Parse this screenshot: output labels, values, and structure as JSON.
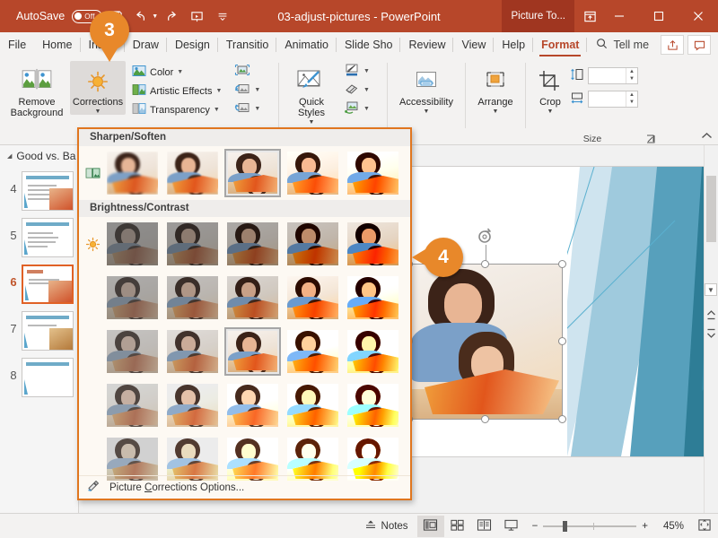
{
  "titlebar": {
    "autosave_label": "AutoSave",
    "autosave_state": "Off",
    "document_title": "03-adjust-pictures  -  PowerPoint",
    "context_tab_badge": "Picture To...",
    "qat": [
      {
        "name": "save-icon",
        "label": "Save"
      },
      {
        "name": "undo-icon",
        "label": "Undo"
      },
      {
        "name": "redo-icon",
        "label": "Redo"
      },
      {
        "name": "start-presentation-icon",
        "label": "Start From Beginning"
      },
      {
        "name": "customize-qat-icon",
        "label": "Customize Quick Access Toolbar"
      }
    ],
    "window_buttons": [
      "minimize",
      "maximize",
      "close"
    ],
    "accent_color": "#b7472a",
    "badge_color": "#a03620"
  },
  "tabs": [
    {
      "label": "File"
    },
    {
      "label": "Home"
    },
    {
      "label": "Insert"
    },
    {
      "label": "Draw"
    },
    {
      "label": "Design"
    },
    {
      "label": "Transitio"
    },
    {
      "label": "Animatio"
    },
    {
      "label": "Slide Sho"
    },
    {
      "label": "Review"
    },
    {
      "label": "View"
    },
    {
      "label": "Help"
    },
    {
      "label": "Format",
      "active": true
    }
  ],
  "tellme": {
    "label": "Tell me",
    "icon": "search-icon"
  },
  "tab_right_buttons": [
    {
      "name": "share-button",
      "icon": "share-icon"
    },
    {
      "name": "comments-button",
      "icon": "comment-icon"
    }
  ],
  "ribbon": {
    "groups": [
      {
        "id": "adjust",
        "label": "",
        "big_buttons": [
          {
            "label": "Remove\nBackground",
            "name": "remove-background-button",
            "icon": "remove-background-icon",
            "selected": false
          },
          {
            "label": "Corrections",
            "name": "corrections-button",
            "icon": "sun-icon",
            "selected": true,
            "has_caret": true
          }
        ],
        "small_buttons": [
          {
            "label": "Color",
            "name": "color-button",
            "icon": "color-picture-icon",
            "caret": true
          },
          {
            "label": "Artistic Effects",
            "name": "artistic-effects-button",
            "icon": "artistic-effects-icon",
            "caret": true
          },
          {
            "label": "Transparency",
            "name": "transparency-button",
            "icon": "transparency-icon",
            "caret": true
          }
        ],
        "icon_buttons": [
          {
            "name": "compress-pictures-button",
            "icon": "compress-picture-icon",
            "caret": false
          },
          {
            "name": "change-picture-button",
            "icon": "change-picture-icon",
            "caret": true
          },
          {
            "name": "reset-picture-button",
            "icon": "reset-picture-icon",
            "caret": true
          }
        ]
      },
      {
        "id": "picture-styles",
        "label": "",
        "big_buttons": [
          {
            "label": "Quick\nStyles",
            "name": "quick-styles-button",
            "icon": "quick-styles-icon",
            "has_caret": true
          }
        ],
        "icon_buttons": [
          {
            "name": "picture-border-button",
            "icon": "pen-border-icon",
            "caret": true
          },
          {
            "name": "picture-effects-button",
            "icon": "eraser-effects-icon",
            "caret": true
          },
          {
            "name": "picture-layout-button",
            "icon": "picture-layout-icon",
            "caret": true
          }
        ]
      },
      {
        "id": "accessibility",
        "label": "",
        "big_buttons": [
          {
            "label": "Accessibility",
            "name": "accessibility-button",
            "icon": "accessibility-icon",
            "has_caret": true
          }
        ]
      },
      {
        "id": "arrange",
        "label": "",
        "big_buttons": [
          {
            "label": "Arrange",
            "name": "arrange-button",
            "icon": "arrange-icon",
            "has_caret": true
          }
        ]
      },
      {
        "id": "size",
        "label": "Size",
        "big_buttons": [
          {
            "label": "Crop",
            "name": "crop-button",
            "icon": "crop-icon",
            "has_caret": true
          }
        ],
        "spinners": [
          {
            "name": "shape-height-input",
            "icon": "height-icon",
            "value": "",
            "placeholder": ""
          },
          {
            "name": "shape-width-input",
            "icon": "width-icon",
            "value": "",
            "placeholder": ""
          }
        ],
        "dialog_launcher": "⊿"
      }
    ],
    "collapse_icon": "chevron-up-icon"
  },
  "thumbnail_pane": {
    "section_title": "Good vs. Ba",
    "slides": [
      {
        "number": "4",
        "title": "What Makes a Bad Presentation",
        "selected": false,
        "has_photo": true
      },
      {
        "number": "5",
        "title": "What Makes a Presentation Good",
        "selected": false,
        "has_photo": false
      },
      {
        "number": "6",
        "title": "Tell a Story",
        "selected": true,
        "has_photo": true
      },
      {
        "number": "7",
        "title": "Do Your Homework",
        "selected": false,
        "has_photo": true
      },
      {
        "number": "8",
        "title": "Parts of a Presentation",
        "selected": false,
        "has_photo": false
      }
    ],
    "collapse_button": "chevron-down-icon"
  },
  "gallery": {
    "sections": [
      {
        "title": "Sharpen/Soften",
        "lead_icon": "sharpen-icon",
        "rows": [
          {
            "thumbs": [
              {
                "selected": false,
                "sharpen": -2
              },
              {
                "selected": false,
                "sharpen": -1
              },
              {
                "selected": true,
                "sharpen": 0
              },
              {
                "selected": false,
                "sharpen": 1
              },
              {
                "selected": false,
                "sharpen": 2
              }
            ]
          }
        ]
      },
      {
        "title": "Brightness/Contrast",
        "lead_icon": "sun-icon",
        "rows": [
          {
            "thumbs": [
              {
                "selected": false,
                "brightness": -40,
                "contrast": -40
              },
              {
                "selected": false,
                "brightness": -40,
                "contrast": -20
              },
              {
                "selected": false,
                "brightness": -40,
                "contrast": 0
              },
              {
                "selected": false,
                "brightness": -40,
                "contrast": 20
              },
              {
                "selected": false,
                "brightness": -40,
                "contrast": 40
              }
            ]
          },
          {
            "thumbs": [
              {
                "selected": false,
                "brightness": -20,
                "contrast": -40
              },
              {
                "selected": false,
                "brightness": -20,
                "contrast": -20
              },
              {
                "selected": false,
                "brightness": -20,
                "contrast": 0
              },
              {
                "selected": false,
                "brightness": -20,
                "contrast": 20
              },
              {
                "selected": false,
                "brightness": -20,
                "contrast": 40
              }
            ]
          },
          {
            "thumbs": [
              {
                "selected": false,
                "brightness": 0,
                "contrast": -40
              },
              {
                "selected": false,
                "brightness": 0,
                "contrast": -20
              },
              {
                "selected": true,
                "brightness": 0,
                "contrast": 0
              },
              {
                "selected": false,
                "brightness": 0,
                "contrast": 20
              },
              {
                "selected": false,
                "brightness": 0,
                "contrast": 40
              }
            ]
          },
          {
            "thumbs": [
              {
                "selected": false,
                "brightness": 20,
                "contrast": -40
              },
              {
                "selected": false,
                "brightness": 20,
                "contrast": -20
              },
              {
                "selected": false,
                "brightness": 20,
                "contrast": 0
              },
              {
                "selected": false,
                "brightness": 20,
                "contrast": 20
              },
              {
                "selected": false,
                "brightness": 20,
                "contrast": 40
              }
            ]
          },
          {
            "thumbs": [
              {
                "selected": false,
                "brightness": 40,
                "contrast": -40
              },
              {
                "selected": false,
                "brightness": 40,
                "contrast": -20
              },
              {
                "selected": false,
                "brightness": 40,
                "contrast": 0
              },
              {
                "selected": false,
                "brightness": 40,
                "contrast": 20
              },
              {
                "selected": false,
                "brightness": 40,
                "contrast": 40
              }
            ]
          }
        ]
      }
    ],
    "footer": {
      "label_before": "Picture ",
      "accel": "C",
      "label_after": "orrections Options...",
      "icon": "corrections-options-icon"
    },
    "border_color": "#e0761f"
  },
  "callouts": [
    {
      "number": "3",
      "direction": "down",
      "target": "corrections-button"
    },
    {
      "number": "4",
      "direction": "left",
      "target": "selected-picture"
    }
  ],
  "slide": {
    "selected_object": "picture",
    "rotation_handle": "rotate-icon"
  },
  "statusbar": {
    "notes_label": "Notes",
    "notes_icon": "notes-icon",
    "views": [
      {
        "name": "normal-view-button",
        "icon": "normal-view-icon",
        "active": true
      },
      {
        "name": "slide-sorter-button",
        "icon": "slide-sorter-icon",
        "active": false
      },
      {
        "name": "reading-view-button",
        "icon": "reading-view-icon",
        "active": false
      },
      {
        "name": "slideshow-button",
        "icon": "slideshow-icon",
        "active": false
      }
    ],
    "zoom_out": "−",
    "zoom_in": "+",
    "zoom_level": "45%",
    "fit_icon": "fit-to-window-icon"
  }
}
